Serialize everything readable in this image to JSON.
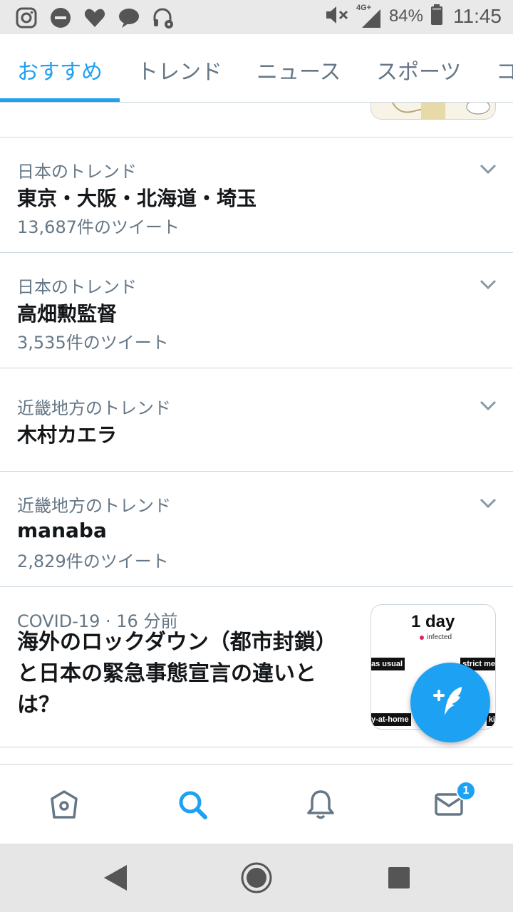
{
  "status_bar": {
    "battery_text": "84%",
    "time": "11:45",
    "network": "4G+",
    "left_icons": [
      "instagram-icon",
      "do-not-disturb-icon",
      "heart-icon",
      "chat-bubble-icon",
      "headset-settings-icon"
    ]
  },
  "tabs": [
    {
      "label": "おすすめ",
      "active": true
    },
    {
      "label": "トレンド",
      "active": false
    },
    {
      "label": "ニュース",
      "active": false
    },
    {
      "label": "スポーツ",
      "active": false
    },
    {
      "label": "コ",
      "active": false
    }
  ],
  "trends": [
    {
      "context": "日本のトレンド",
      "title": "東京・大阪・北海道・埼玉",
      "count": "13,687件のツイート"
    },
    {
      "context": "日本のトレンド",
      "title": "高畑勲監督",
      "count": "3,535件のツイート"
    },
    {
      "context": "近畿地方のトレンド",
      "title": "木村カエラ",
      "count": ""
    },
    {
      "context": "近畿地方のトレンド",
      "title": "manaba",
      "count": "2,829件のツイート"
    }
  ],
  "news": {
    "meta": "COVID-19 · 16 分前",
    "title": "海外のロックダウン（都市封鎖）と日本の緊急事態宣言の違いとは？",
    "thumb": {
      "heading": "1 day",
      "sub": "infected",
      "left_label": "as usual",
      "right_label": "strict me",
      "bottom_left": "y-at-home",
      "bottom_right": "ki"
    }
  },
  "bottom_nav": {
    "items": [
      "home-icon",
      "search-icon",
      "notifications-icon",
      "messages-icon"
    ],
    "messages_badge": "1"
  },
  "colors": {
    "accent": "#1da1f2",
    "secondary_text": "#657786",
    "primary_text": "#14171a",
    "divider": "#ccd6dd"
  }
}
